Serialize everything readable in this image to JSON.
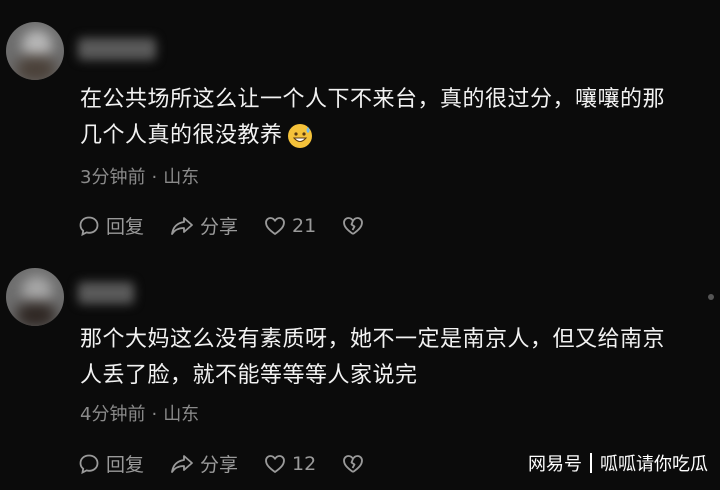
{
  "comments": [
    {
      "text_line1": "在公共场所这么让一个人下不来台，真的很过分，嚷嚷的那",
      "text_line2": "几个人真的很没教养",
      "emoji": "grinning-sweat-emoji",
      "time": "3分钟前",
      "location": "山东",
      "reply_label": "回复",
      "share_label": "分享",
      "like_count": "21"
    },
    {
      "text_line1": "那个大妈这么没有素质呀，她不一定是南京人，但又给南京",
      "text_line2": "人丢了脸，就不能等等等人家说完",
      "time": "4分钟前",
      "location": "山东",
      "reply_label": "回复",
      "share_label": "分享",
      "like_count": "12"
    }
  ],
  "watermark": {
    "brand": "网易号",
    "account": "呱呱请你吃瓜"
  },
  "colors": {
    "background": "#0b0b0b",
    "text": "#f2f2f2",
    "meta": "#8a8a8a",
    "action": "#9a9a9a"
  }
}
